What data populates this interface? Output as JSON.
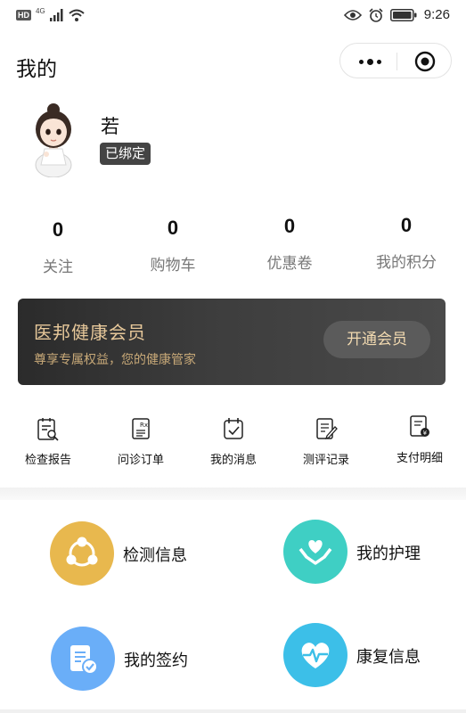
{
  "status_bar": {
    "hd": "HD",
    "network": "4G",
    "time": "9:26",
    "icons": [
      "signal-icon",
      "wifi-icon",
      "eye-icon",
      "alarm-icon",
      "battery-icon"
    ]
  },
  "header": {
    "title": "我的",
    "capsule_icons": [
      "more-icon",
      "close-target-icon"
    ]
  },
  "profile": {
    "name": "若",
    "badge": "已绑定"
  },
  "stats": [
    {
      "value": "0",
      "label": "关注"
    },
    {
      "value": "0",
      "label": "购物车"
    },
    {
      "value": "0",
      "label": "优惠卷"
    },
    {
      "value": "0",
      "label": "我的积分"
    }
  ],
  "membership": {
    "title": "医邦健康会员",
    "subtitle": "尊享专属权益，您的健康管家",
    "button": "开通会员"
  },
  "tools": [
    {
      "label": "检查报告",
      "icon": "report-search-icon"
    },
    {
      "label": "问诊订单",
      "icon": "prescription-icon"
    },
    {
      "label": "我的消息",
      "icon": "calendar-check-icon"
    },
    {
      "label": "测评记录",
      "icon": "edit-note-icon"
    },
    {
      "label": "支付明细",
      "icon": "payment-doc-icon"
    }
  ],
  "features": [
    {
      "label": "检测信息",
      "icon": "network-icon",
      "color": "#e8b84e"
    },
    {
      "label": "我的护理",
      "icon": "care-hands-icon",
      "color": "#3fcfc4"
    },
    {
      "label": "我的签约",
      "icon": "contract-icon",
      "color": "#6aaef8"
    },
    {
      "label": "康复信息",
      "icon": "heart-pulse-icon",
      "color": "#3cbfe8"
    }
  ]
}
